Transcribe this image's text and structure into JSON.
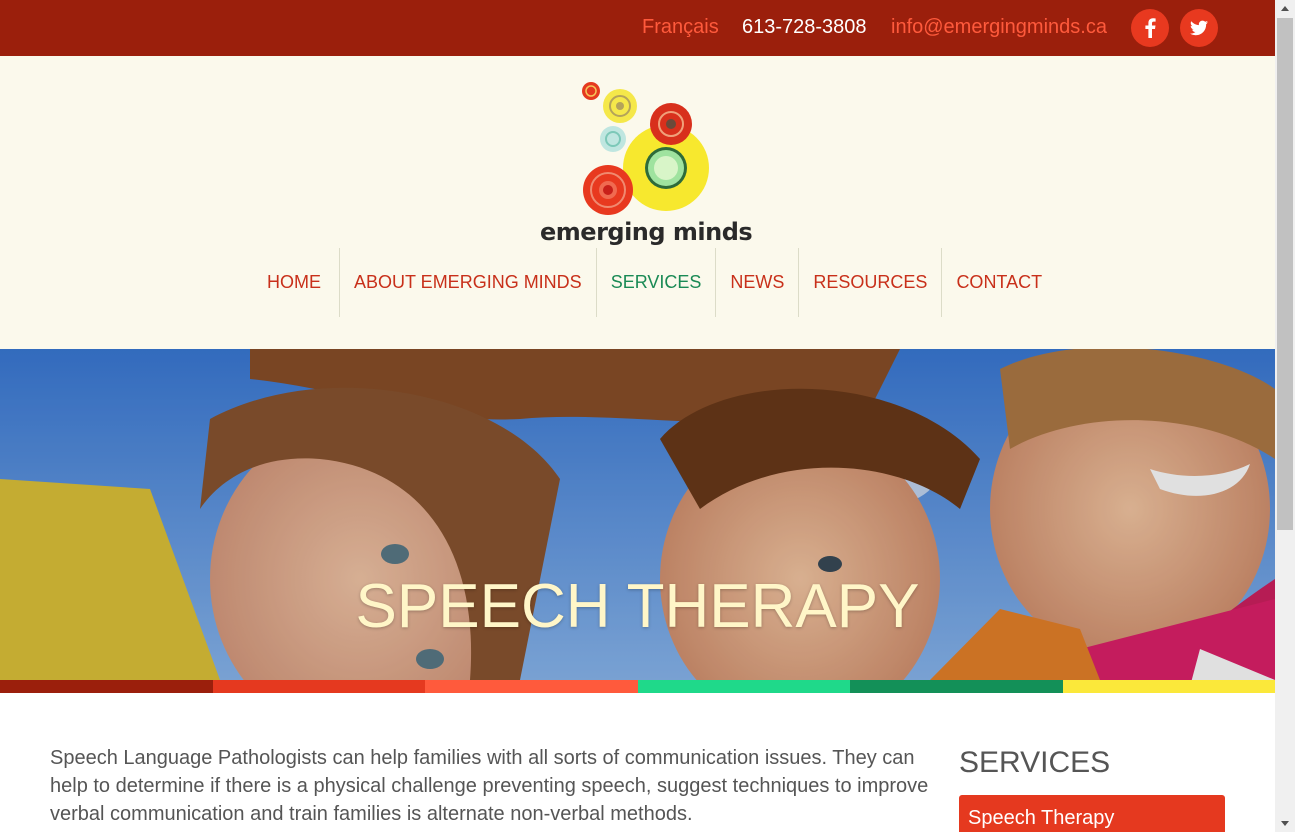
{
  "topbar": {
    "language_link": "Français",
    "phone": "613-728-3808",
    "email": "info@emergingminds.ca",
    "facebook_icon": "facebook-icon",
    "twitter_icon": "twitter-icon"
  },
  "brand": {
    "logo_text": "emerging minds"
  },
  "nav": {
    "items": [
      {
        "label": "HOME"
      },
      {
        "label": "ABOUT EMERGING MINDS"
      },
      {
        "label": "SERVICES"
      },
      {
        "label": "NEWS"
      },
      {
        "label": "RESOURCES"
      },
      {
        "label": "CONTACT"
      }
    ],
    "active": "SERVICES"
  },
  "hero": {
    "title": "SPEECH THERAPY"
  },
  "content": {
    "intro": "Speech Language Pathologists can help families with all sorts of communication issues. They can help to determine if there is a physical challenge preventing speech, suggest techniques to improve verbal communication and train families is alternate non-verbal methods."
  },
  "sidebar": {
    "title": "SERVICES",
    "items": [
      {
        "label": "Speech Therapy"
      }
    ]
  },
  "colors": {
    "topbar": "#9b1f0c",
    "accent": "#e5391f",
    "nav_active": "#1a8a55",
    "header_bg": "#fbf9ec",
    "stripe": [
      "#9b1f0c",
      "#e5391f",
      "#ff5a3c",
      "#1fd98a",
      "#139058",
      "#fbe83a"
    ]
  }
}
